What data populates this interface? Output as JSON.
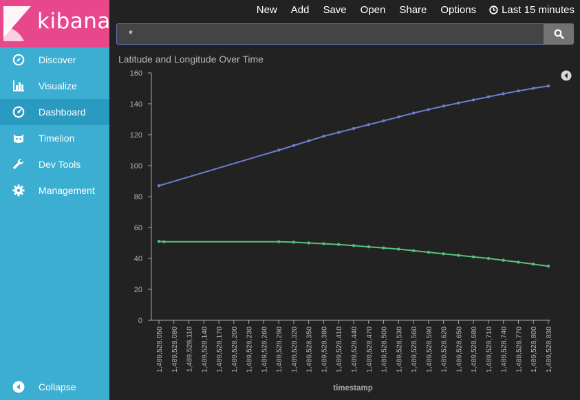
{
  "brand": {
    "name": "kibana"
  },
  "nav": {
    "items": [
      {
        "label": "Discover",
        "icon": "compass-icon"
      },
      {
        "label": "Visualize",
        "icon": "bar-chart-icon"
      },
      {
        "label": "Dashboard",
        "icon": "dashboard-gauge-icon",
        "active": true
      },
      {
        "label": "Timelion",
        "icon": "timelion-cat-icon"
      },
      {
        "label": "Dev Tools",
        "icon": "wrench-icon"
      },
      {
        "label": "Management",
        "icon": "gear-icon"
      }
    ],
    "collapse_label": "Collapse"
  },
  "topmenu": {
    "new": "New",
    "add": "Add",
    "save": "Save",
    "open": "Open",
    "share": "Share",
    "options": "Options",
    "time_range": "Last 15 minutes"
  },
  "search": {
    "query": "*"
  },
  "panel": {
    "title": "Latitude and Longitude Over Time"
  },
  "colors": {
    "sidebar": "#3caed2",
    "logo": "#e8488b",
    "active_nav": "#2a9ac0",
    "series_longitude": "#6d7dd1",
    "series_latitude": "#57c17b"
  },
  "chart_data": {
    "type": "line",
    "title": "Latitude and Longitude Over Time",
    "xlabel": "timestamp",
    "ylabel": "",
    "ylim": [
      0,
      160
    ],
    "yticks": [
      0,
      20,
      40,
      60,
      80,
      100,
      120,
      140,
      160
    ],
    "xticks": [
      "1,489,528,050",
      "1,489,528,080",
      "1,489,528,110",
      "1,489,528,140",
      "1,489,528,170",
      "1,489,528,200",
      "1,489,528,230",
      "1,489,528,260",
      "1,489,528,290",
      "1,489,528,320",
      "1,489,528,350",
      "1,489,528,380",
      "1,489,528,410",
      "1,489,528,440",
      "1,489,528,470",
      "1,489,528,500",
      "1,489,528,530",
      "1,489,528,560",
      "1,489,528,590",
      "1,489,528,620",
      "1,489,528,650",
      "1,489,528,680",
      "1,489,528,710",
      "1,489,528,740",
      "1,489,528,770",
      "1,489,528,800",
      "1,489,528,830"
    ],
    "grid": false,
    "series": [
      {
        "color": "#6d7dd1",
        "points": [
          [
            1489528050,
            87
          ],
          [
            1489528290,
            110
          ],
          [
            1489528320,
            113
          ],
          [
            1489528350,
            116
          ],
          [
            1489528380,
            119
          ],
          [
            1489528410,
            121.5
          ],
          [
            1489528440,
            124
          ],
          [
            1489528470,
            126.5
          ],
          [
            1489528500,
            129
          ],
          [
            1489528530,
            131.5
          ],
          [
            1489528560,
            134
          ],
          [
            1489528590,
            136.3
          ],
          [
            1489528620,
            138.5
          ],
          [
            1489528650,
            140.5
          ],
          [
            1489528680,
            142.5
          ],
          [
            1489528710,
            144.5
          ],
          [
            1489528740,
            146.5
          ],
          [
            1489528770,
            148.3
          ],
          [
            1489528800,
            150
          ],
          [
            1489528830,
            151.5
          ]
        ]
      },
      {
        "color": "#57c17b",
        "points": [
          [
            1489528050,
            51
          ],
          [
            1489528060,
            50.8
          ],
          [
            1489528290,
            50.8
          ],
          [
            1489528320,
            50.5
          ],
          [
            1489528350,
            50
          ],
          [
            1489528380,
            49.5
          ],
          [
            1489528410,
            49
          ],
          [
            1489528440,
            48.3
          ],
          [
            1489528470,
            47.5
          ],
          [
            1489528500,
            46.8
          ],
          [
            1489528530,
            46
          ],
          [
            1489528560,
            45
          ],
          [
            1489528590,
            44
          ],
          [
            1489528620,
            43
          ],
          [
            1489528650,
            42
          ],
          [
            1489528680,
            41
          ],
          [
            1489528710,
            40
          ],
          [
            1489528740,
            38.8
          ],
          [
            1489528770,
            37.6
          ],
          [
            1489528800,
            36.3
          ],
          [
            1489528830,
            35
          ]
        ]
      }
    ]
  }
}
